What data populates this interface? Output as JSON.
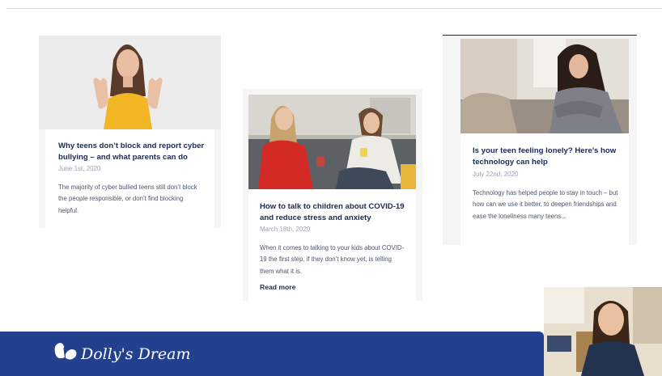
{
  "cards": [
    {
      "title": "Why teens don’t block and report cyber bullying – and what parents can do",
      "date": "June 1st, 2020",
      "excerpt": "The majority of cyber bullied teens still don’t block the people responsible, or don’t find blocking helpful.",
      "image": "teen-hands-raised-photo"
    },
    {
      "title": "How to talk to children about COVID-19 and reduce stress and anxiety",
      "date": "March 18th, 2020",
      "excerpt": "When it comes to talking to your kids about COVID-19 the first step, if they don’t know yet, is telling them what it is.",
      "read_more": "Read more",
      "image": "two-women-talking-photo"
    },
    {
      "title": "Is your teen feeling lonely? Here’s how technology can help",
      "date": "July 22nd, 2020",
      "excerpt": "Technology has helped people to stay in touch – but how can we use it better, to deepen friendships and ease the loneliness many teens...",
      "image": "lonely-teen-on-couch-photo"
    }
  ],
  "footer": {
    "brand": "Dolly's Dream",
    "logo_icon": "butterfly-icon",
    "color": "#23408e"
  },
  "video": {
    "icon": "presenter-webcam"
  }
}
